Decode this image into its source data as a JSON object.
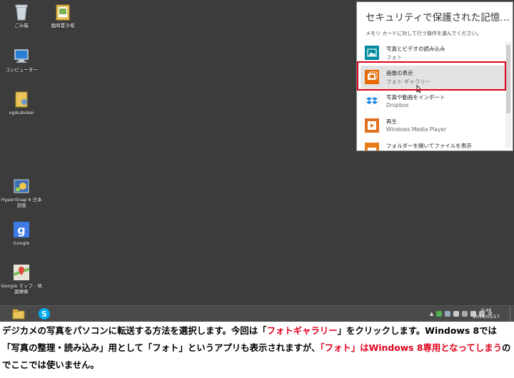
{
  "desktop": {
    "icons": [
      {
        "label": "ごみ箱"
      },
      {
        "label": "臨時置き場"
      },
      {
        "label": "コンピューター"
      },
      {
        "label": "ogikubokei"
      },
      {
        "label": "HyperSnap 6 日本語版"
      },
      {
        "label": "Google"
      },
      {
        "label": "Google マップ - 地図検索"
      }
    ]
  },
  "taskbar": {
    "clock_time": "0:46",
    "clock_date": "2014/05/17"
  },
  "autoplay": {
    "title": "セキュリティで保護された記憶…",
    "subtitle": "メモリ カードに対して行う操作を選んでください。",
    "options": [
      {
        "line1": "写真とビデオの読み込み",
        "line2": "フォト",
        "icon": "photos-app-icon",
        "color": "#008a9e"
      },
      {
        "line1": "画像の表示",
        "line2": "フォト ギャラリー",
        "icon": "photo-gallery-icon",
        "color": "#e66a00"
      },
      {
        "line1": "写真や動画をインポート",
        "line2": "Dropbox",
        "icon": "dropbox-icon",
        "color": "#1e88e5"
      },
      {
        "line1": "再生",
        "line2": "Windows Media Player",
        "icon": "media-player-icon",
        "color": "#e0701f"
      },
      {
        "line1": "フォルダーを開いてファイルを表示",
        "line2": "",
        "icon": "explorer-icon",
        "color": "#e87b18"
      }
    ]
  },
  "caption": {
    "p1": "デジカメの写真をパソコンに転送する方法を選択します。今回は「",
    "r1": "フォトギャラリー",
    "p2": "」をクリックします。Windows 8では「写真の整理・読み込み」用として「フォト」というアプリも表示されますが、",
    "r2": "「フォト」はWindows 8専用となってしまう",
    "p3": "のでここでは使いません。"
  }
}
